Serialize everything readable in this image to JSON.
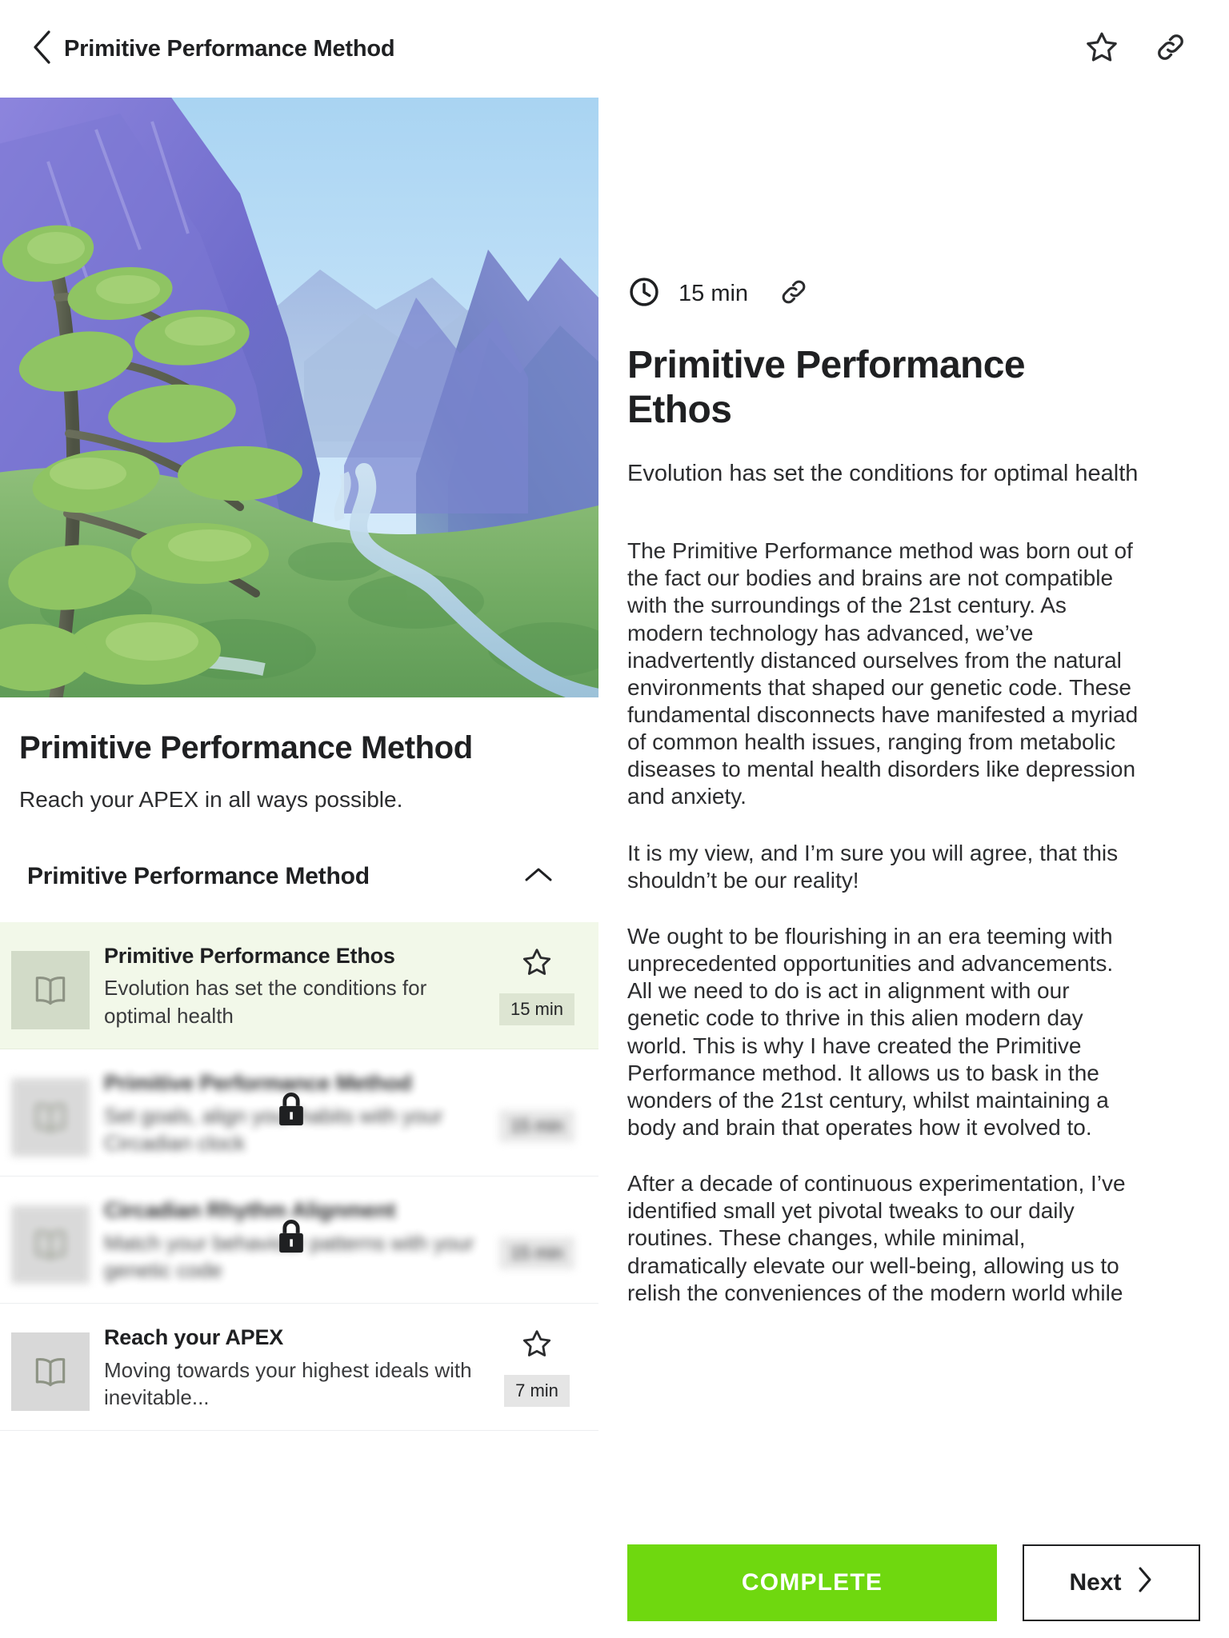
{
  "topbar": {
    "back_icon": "chevron-left-icon",
    "title": "Primitive Performance Method",
    "favorite_icon": "star-outline-icon",
    "link_icon": "link-icon"
  },
  "course": {
    "hero_image_alt": "mountain-valley-landscape",
    "title": "Primitive Performance Method",
    "subtitle": "Reach your APEX in all ways possible.",
    "section": {
      "title": "Primitive Performance Method",
      "collapse_icon": "chevron-up-icon",
      "expanded": true
    },
    "lessons": [
      {
        "title": "Primitive Performance Ethos",
        "description": "Evolution has set the conditions for optimal health",
        "duration": "15 min",
        "icon": "book-icon",
        "star_icon": "star-outline-icon",
        "active": true,
        "locked": false
      },
      {
        "title": "Primitive Performance Method",
        "description": "Set goals, align your habits with your Circadian clock",
        "duration": "15 min",
        "icon": "book-icon",
        "lock_icon": "lock-icon",
        "active": false,
        "locked": true
      },
      {
        "title": "Circadian Rhythm Alignment",
        "description": "Match your behaviour patterns with your genetic code",
        "duration": "15 min",
        "icon": "book-icon",
        "lock_icon": "lock-icon",
        "active": false,
        "locked": true
      },
      {
        "title": "Reach your APEX",
        "description": "Moving towards your highest ideals with inevitable...",
        "duration": "7 min",
        "icon": "book-icon",
        "star_icon": "star-outline-icon",
        "active": false,
        "locked": false
      }
    ]
  },
  "article": {
    "clock_icon": "clock-icon",
    "duration": "15 min",
    "link_icon": "link-icon",
    "title": "Primitive Performance Ethos",
    "subtitle": "Evolution has set the conditions for optimal health",
    "paragraphs": [
      "The Primitive Performance method was born out of the fact our bodies and brains are not compatible with the surroundings of the 21st century. As modern technology has advanced, we’ve inadvertently distanced ourselves from the natural environments that shaped our genetic code. These fundamental disconnects have manifested a myriad of common health issues, ranging from metabolic diseases to mental health disorders like depression and anxiety.",
      "It is my view, and I’m sure you will agree, that this shouldn’t be our reality!",
      "We ought to be flourishing in an era teeming with unprecedented opportunities and advancements. All we need to do is act in alignment with our genetic code to thrive in this alien modern day world. This is why I have created the Primitive Performance method. It allows us to bask in the wonders of the 21st century, whilst maintaining a body and brain that operates how it evolved to.",
      "After a decade of continuous experimentation, I’ve identified small yet pivotal tweaks to our daily routines. These changes, while minimal, dramatically elevate our well-being, allowing us to relish the conveniences of the modern world while"
    ]
  },
  "actions": {
    "complete_label": "COMPLETE",
    "next_label": "Next",
    "next_icon": "chevron-right-icon"
  },
  "colors": {
    "accent_green": "#6fd80f",
    "active_row_bg": "#f2f8e9",
    "text": "#1f2022"
  }
}
